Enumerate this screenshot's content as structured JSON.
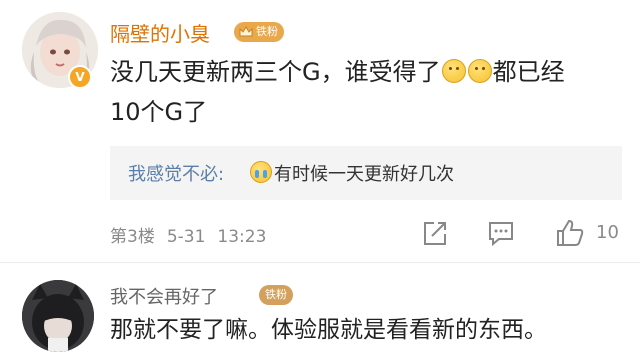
{
  "comment1": {
    "username": "隔壁的小臭",
    "fan_badge": "铁粉",
    "text_line1_a": "没几天更新两三个G，谁受得了",
    "text_line1_b": "都已经",
    "text_line2": "10个G了",
    "reply": {
      "name": "我感觉不必:",
      "text": "有时候一天更新好几次"
    },
    "floor": "第3楼",
    "date": "5-31",
    "time": "13:23",
    "like_count": "10"
  },
  "comment2": {
    "username": "我不会再好了",
    "fan_badge": "铁粉",
    "text": "那就不要了嘛。体验服就是看看新的东西。"
  },
  "colors": {
    "username_orange": "#e07300",
    "reply_name_blue": "#5b7fa8",
    "badge_gold": "#e9a84c",
    "meta_gray": "#8a8a8a"
  },
  "icons": [
    "share-icon",
    "comment-icon",
    "like-icon",
    "smile-emoji",
    "cry-emoji",
    "verified-badge-icon",
    "crown-icon"
  ]
}
